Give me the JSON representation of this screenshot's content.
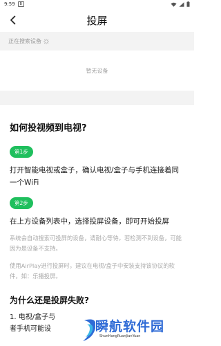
{
  "status_bar": {
    "time": "9:59",
    "badge": "B"
  },
  "nav": {
    "title": "投屏"
  },
  "devices": {
    "searching_label": "正在搜索设备",
    "empty_label": "暂无设备"
  },
  "help": {
    "title": "如何投视频到电视?",
    "step1_badge": "第1步",
    "step1_text": "打开智能电视或盒子，确认电视/盒子与手机连接着同一个WiFi",
    "step2_badge": "第2步",
    "step2_text": "在上方设备列表中，选择投屏设备，即可开始投屏",
    "note1": "系统会自动搜索可投屏的设备，请耐心等待。若检测不到设备，可能因为是设备不支持。",
    "note2": "使用AirPlay进行投屏时，建议在电视/盒子中安装支持该协议的软件，如：乐播投屏。",
    "fail_title": "为什么还是投屏失败?",
    "fail_line1": "1. 电视/盒子与",
    "fail_line2": "者手机可能设"
  },
  "watermark": {
    "name": "瞬航软件园",
    "url": "ShunHangRuanJianYuan"
  },
  "colors": {
    "accent": "#1fbf5d",
    "watermark": "#2f6bd6"
  }
}
